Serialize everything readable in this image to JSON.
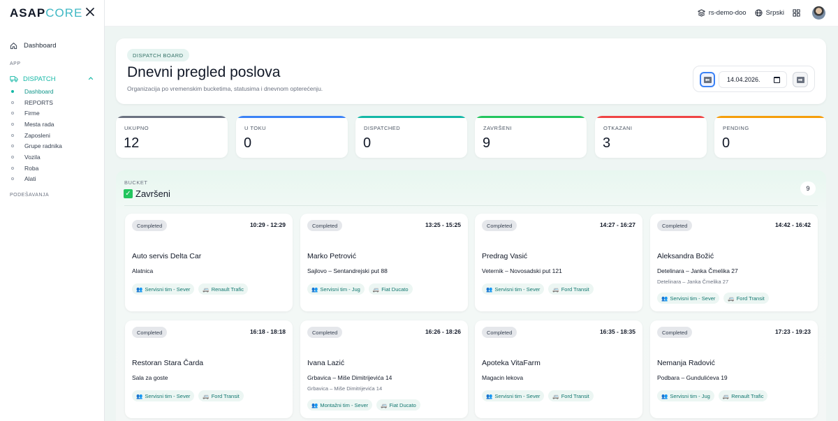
{
  "sidebar": {
    "logo_main": "ASAP",
    "logo_accent": "CORE",
    "dashboard": "Dashboard",
    "section_app": "APP",
    "dispatch": "DISPATCH",
    "items": [
      {
        "label": "Dashboard",
        "active": true
      },
      {
        "label": "REPORTS"
      },
      {
        "label": "Firme"
      },
      {
        "label": "Mesta rada"
      },
      {
        "label": "Zaposleni"
      },
      {
        "label": "Grupe radnika"
      },
      {
        "label": "Vozila"
      },
      {
        "label": "Roba"
      },
      {
        "label": "Alati"
      }
    ],
    "section_settings": "PODEŠAVANJA"
  },
  "topbar": {
    "tenant": "rs-demo-doo",
    "language": "Srpski"
  },
  "header": {
    "badge": "DISPATCH BOARD",
    "title": "Dnevni pregled poslova",
    "subtitle": "Organizacija po vremenskim bucketima, statusima i dnevnom opterećenju.",
    "date": "14.04.2026."
  },
  "stats": [
    {
      "label": "UKUPNO",
      "value": "12",
      "color": "#6b7280"
    },
    {
      "label": "U TOKU",
      "value": "0",
      "color": "#3b82f6"
    },
    {
      "label": "DISPATCHED",
      "value": "0",
      "color": "#14b8a6"
    },
    {
      "label": "ZAVRŠENI",
      "value": "9",
      "color": "#22c55e"
    },
    {
      "label": "OTKAZANI",
      "value": "3",
      "color": "#ef4444"
    },
    {
      "label": "PENDING",
      "value": "0",
      "color": "#f59e0b"
    }
  ],
  "bucket": {
    "label": "BUCKET",
    "title": "Završeni",
    "count": "9"
  },
  "jobs": [
    {
      "status": "Completed",
      "time": "10:29 - 12:29",
      "client": "Auto servis Delta Car",
      "address": "Alatnica",
      "address2": "",
      "team": "Servisni tim - Sever",
      "vehicle": "Renault Trafic"
    },
    {
      "status": "Completed",
      "time": "13:25 - 15:25",
      "client": "Marko Petrović",
      "address": "Sajlovo – Sentandrejski put 88",
      "address2": "",
      "team": "Servisni tim - Jug",
      "vehicle": "Fiat Ducato"
    },
    {
      "status": "Completed",
      "time": "14:27 - 16:27",
      "client": "Predrag Vasić",
      "address": "Veternik – Novosadski put 121",
      "address2": "",
      "team": "Servisni tim - Sever",
      "vehicle": "Ford Transit"
    },
    {
      "status": "Completed",
      "time": "14:42 - 16:42",
      "client": "Aleksandra Božić",
      "address": "Detelinara – Janka Čmelika 27",
      "address2": "Detelinara – Janka Čmelika 27",
      "team": "Servisni tim - Sever",
      "vehicle": "Ford Transit"
    },
    {
      "status": "Completed",
      "time": "16:18 - 18:18",
      "client": "Restoran Stara Čarda",
      "address": "Sala za goste",
      "address2": "",
      "team": "Servisni tim - Sever",
      "vehicle": "Ford Transit"
    },
    {
      "status": "Completed",
      "time": "16:26 - 18:26",
      "client": "Ivana Lazić",
      "address": "Grbavica – Miše Dimitrijevića 14",
      "address2": "Grbavica – Miše Dimitrijevića 14",
      "team": "Montažni tim - Sever",
      "vehicle": "Fiat Ducato"
    },
    {
      "status": "Completed",
      "time": "16:35 - 18:35",
      "client": "Apoteka VitaFarm",
      "address": "Magacin lekova",
      "address2": "",
      "team": "Servisni tim - Sever",
      "vehicle": "Ford Transit"
    },
    {
      "status": "Completed",
      "time": "17:23 - 19:23",
      "client": "Nemanja Radović",
      "address": "Podbara – Gundulićeva 19",
      "address2": "",
      "team": "Servisni tim - Jug",
      "vehicle": "Renault Trafic"
    }
  ]
}
